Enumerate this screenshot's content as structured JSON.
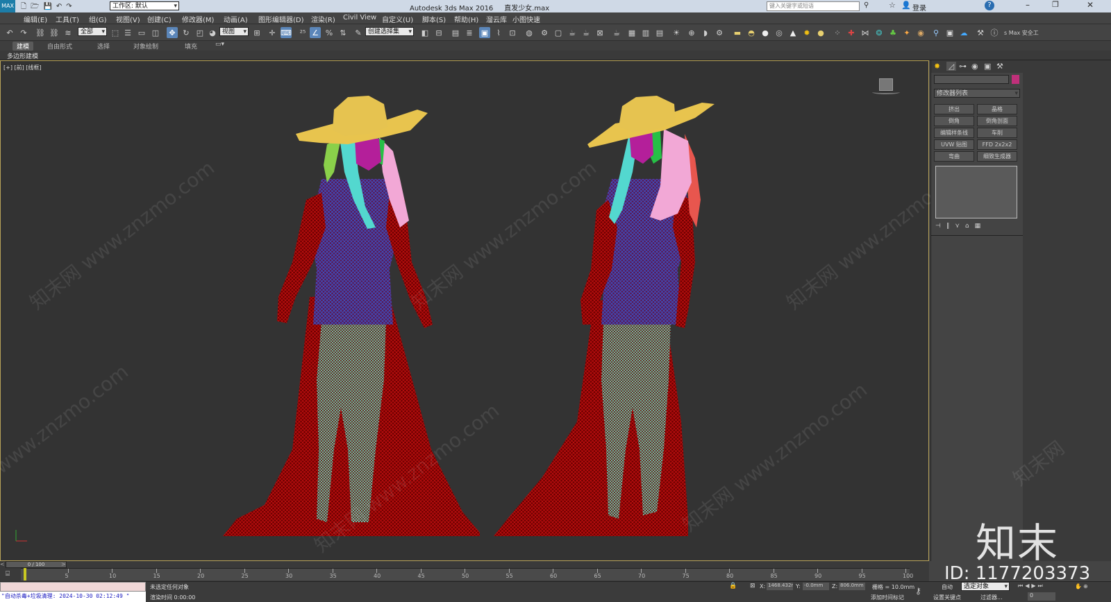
{
  "title": {
    "app": "Autodesk 3ds Max 2016",
    "file": "直发少女.max",
    "workspace_label": "工作区: 默认",
    "search_placeholder": "键入关键字或短语",
    "login": "登录"
  },
  "menu": [
    "编辑(E)",
    "工具(T)",
    "组(G)",
    "视图(V)",
    "创建(C)",
    "修改器(M)",
    "动画(A)",
    "图形编辑器(D)",
    "渲染(R)",
    "Civil View",
    "自定义(U)",
    "脚本(S)",
    "帮助(H)",
    "溜云库",
    "小图快速"
  ],
  "toolbar": {
    "selection_filter": "全部",
    "ref_coord": "视图",
    "named_selection": "创建选择集",
    "safe_label": "s Max 安全工"
  },
  "ribbon": {
    "tabs": [
      "建模",
      "自由形式",
      "选择",
      "对象绘制",
      "填充"
    ],
    "sub_label": "多边形建模"
  },
  "viewport": {
    "label": "[+] [前] [线框]"
  },
  "cmdpanel": {
    "modifier_list": "修改器列表",
    "buttons": [
      "挤出",
      "晶格",
      "倒角",
      "倒角剖面",
      "编辑样条线",
      "车削",
      "UVW 贴图",
      "FFD 2x2x2",
      "弯曲",
      "细致生成器"
    ],
    "accent_color": "#c0307a"
  },
  "timeline": {
    "frame_counter": "0 / 100",
    "ticks": [
      5,
      10,
      15,
      20,
      25,
      30,
      35,
      40,
      45,
      50,
      55,
      60,
      65,
      70,
      75,
      80,
      85,
      90,
      95,
      100
    ]
  },
  "status": {
    "maxscript": "\"自动杀毒+垃圾清理: 2024-10-30 02:12:49 \"",
    "selection": "未选定任何对象",
    "render_time": "渲染时间 0:00:00",
    "x_label": "X:",
    "x_value": "1468.432r",
    "y_label": "Y:",
    "y_value": "-0.0mm",
    "z_label": "Z:",
    "z_value": "806.0mm",
    "grid": "栅格 = 10.0mm",
    "auto": "自动",
    "selected_obj": "选定对象",
    "set_key": "设置关键点",
    "filters": "过滤器...",
    "add_time_tag": "添加时间标记",
    "frame_field": "0"
  },
  "watermark": {
    "site": "www.znzmo.com",
    "cn_brand": "知末网",
    "brand_large": "知末",
    "id_text": "ID: 1177203373"
  }
}
